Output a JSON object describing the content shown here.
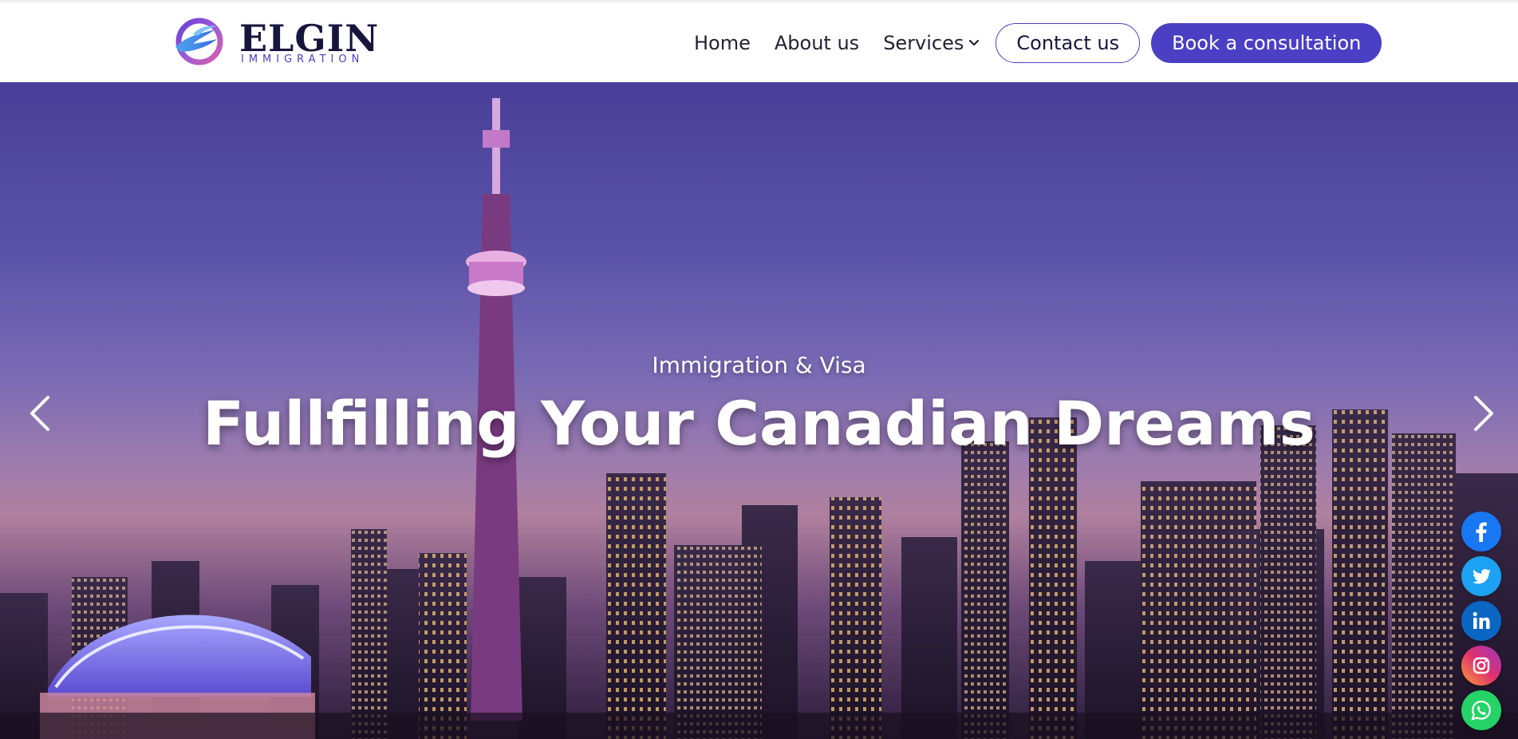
{
  "brand": {
    "name": "ELGIN",
    "tagline": "IMMIGRATION",
    "accent_color": "#4b3fc4"
  },
  "nav": {
    "home": "Home",
    "about": "About us",
    "services": "Services",
    "contact": "Contact us",
    "book": "Book a consultation"
  },
  "hero": {
    "subtitle": "Immigration & Visa",
    "title": "Fullfilling Your Canadian Dreams"
  },
  "social": [
    {
      "name": "facebook-icon",
      "color": "#1877f2"
    },
    {
      "name": "twitter-icon",
      "color": "#1da1f2"
    },
    {
      "name": "linkedin-icon",
      "color": "#0a66c2"
    },
    {
      "name": "instagram-icon",
      "color": "#e1306c"
    },
    {
      "name": "whatsapp-icon",
      "color": "#25d366"
    }
  ]
}
